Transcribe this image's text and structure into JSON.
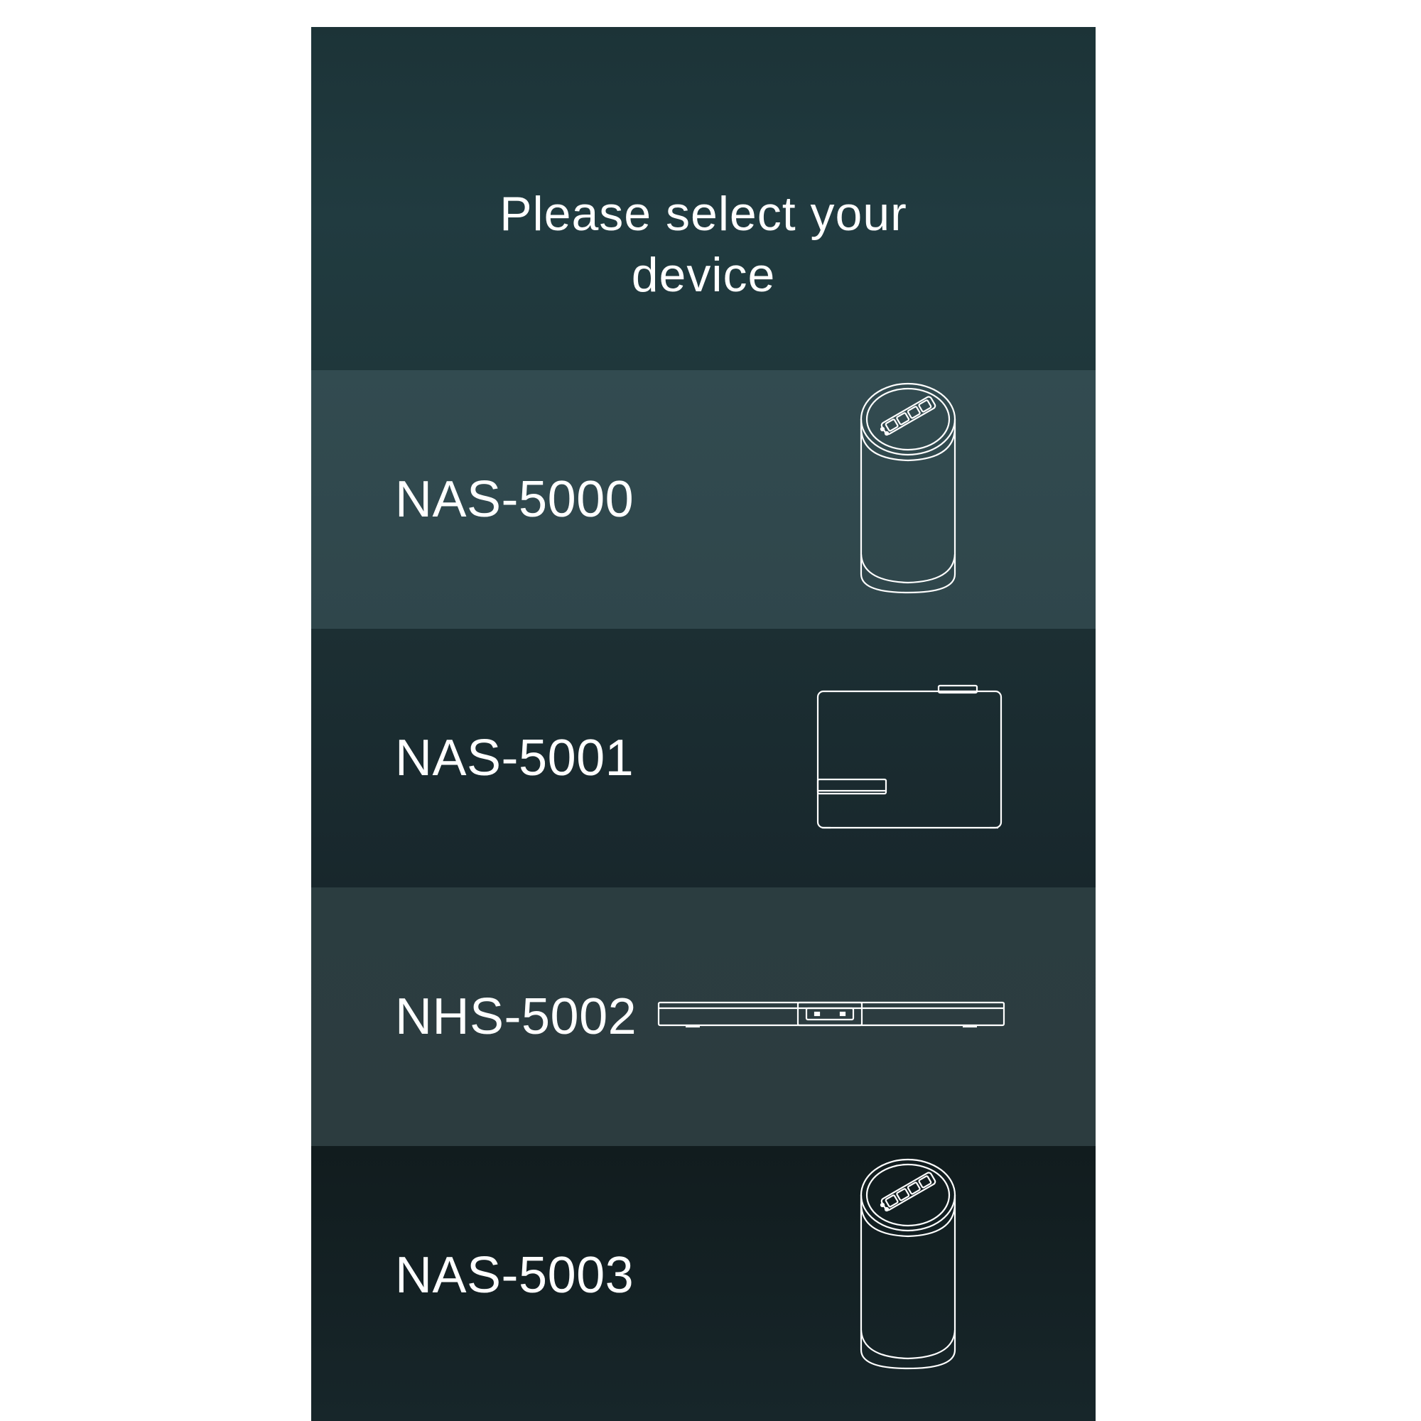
{
  "screen": {
    "title_lines": [
      "Please select your",
      "device"
    ]
  },
  "devices": [
    {
      "label": "NAS-5000",
      "icon": "cylinder-nas-device-icon"
    },
    {
      "label": "NAS-5001",
      "icon": "box-nas-device-icon"
    },
    {
      "label": "NHS-5002",
      "icon": "flat-bar-device-icon"
    },
    {
      "label": "NAS-5003",
      "icon": "cylinder-nas-device-icon"
    }
  ],
  "colors": {
    "text": "#ffffff",
    "header_bg": "#1f373b",
    "row_highlight_bg": "#324b50",
    "row_dark_bg": "#18272c"
  }
}
